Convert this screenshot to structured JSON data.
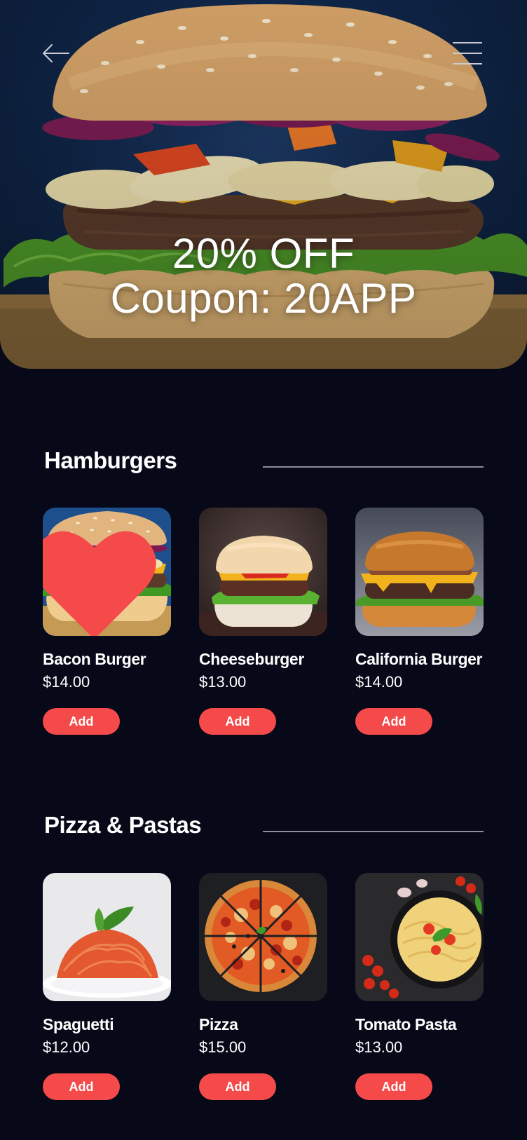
{
  "hero": {
    "headline": "20% OFF",
    "coupon": "Coupon: 20APP",
    "back_icon": "arrow-left-icon",
    "menu_icon": "hamburger-menu-icon"
  },
  "colors": {
    "background": "#070818",
    "accent": "#f44a4a",
    "heart": "#f44a4a"
  },
  "sections": [
    {
      "title": "Hamburgers",
      "items": [
        {
          "name": "Bacon Burger",
          "price": "$14.00",
          "button": "Add",
          "favorited": true
        },
        {
          "name": "Cheeseburger",
          "price": "$13.00",
          "button": "Add",
          "favorited": false
        },
        {
          "name": "California Burger",
          "price": "$14.00",
          "button": "Add",
          "favorited": false
        }
      ]
    },
    {
      "title": "Pizza & Pastas",
      "items": [
        {
          "name": "Spaguetti",
          "price": "$12.00",
          "button": "Add",
          "favorited": false
        },
        {
          "name": "Pizza",
          "price": "$15.00",
          "button": "Add",
          "favorited": false
        },
        {
          "name": "Tomato Pasta",
          "price": "$13.00",
          "button": "Add",
          "favorited": false
        }
      ]
    }
  ]
}
